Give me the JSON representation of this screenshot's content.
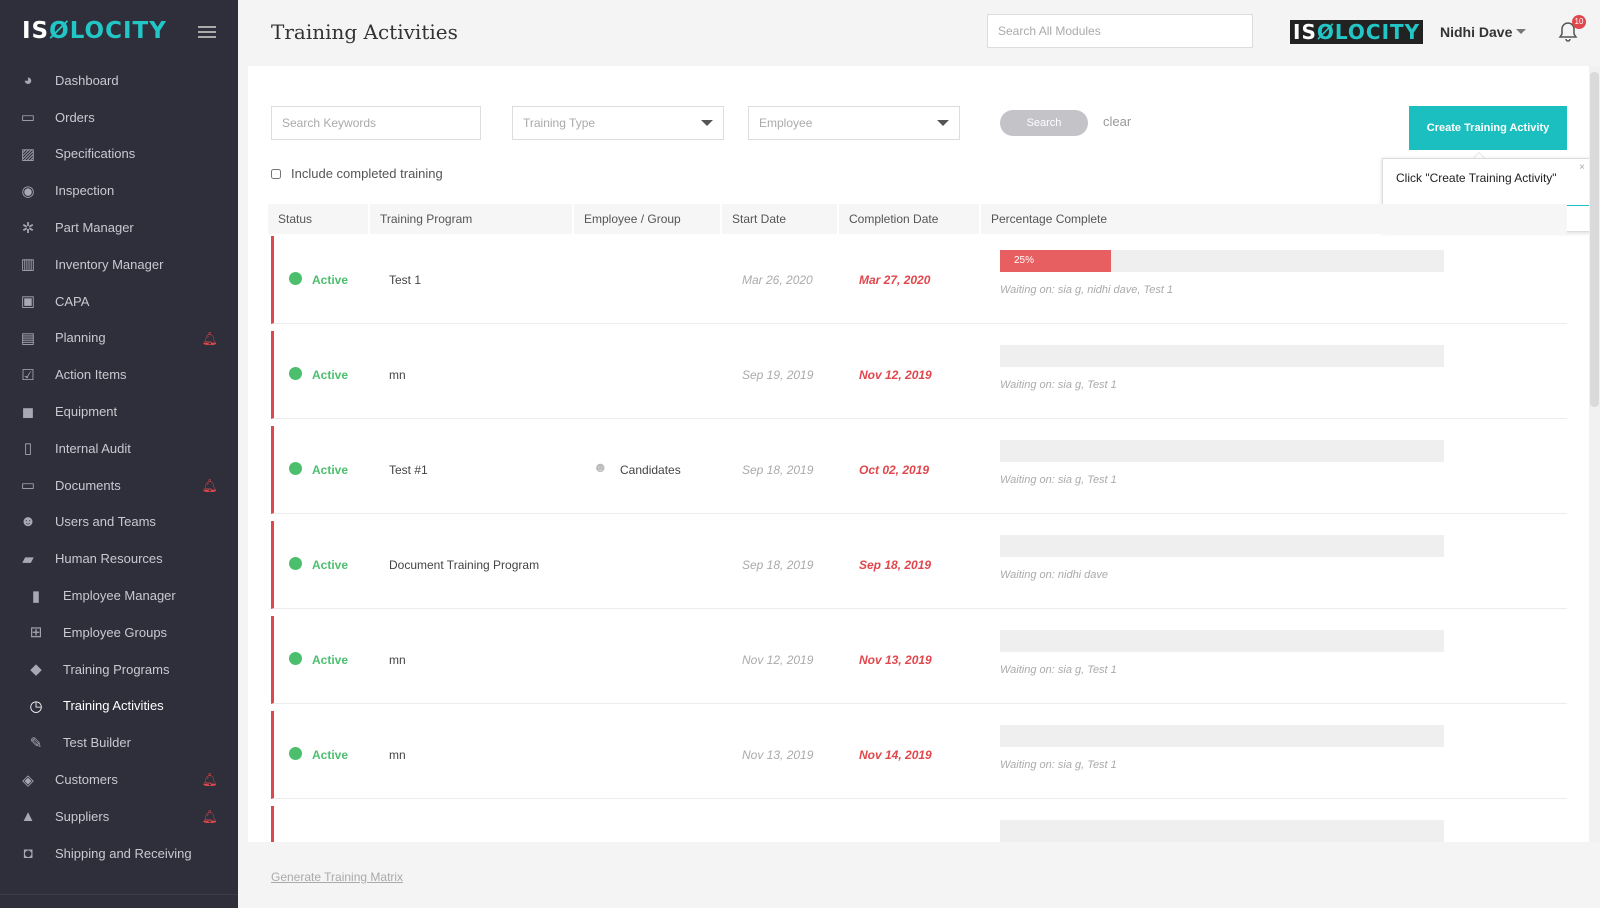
{
  "sidebar": {
    "logo": {
      "part1": "IS",
      "o": "Ø",
      "part2": "LOCITY"
    },
    "items": [
      {
        "label": "Dashboard",
        "icon": "dashboard-icon"
      },
      {
        "label": "Orders",
        "icon": "inbox-icon"
      },
      {
        "label": "Specifications",
        "icon": "image-icon"
      },
      {
        "label": "Inspection",
        "icon": "eye-icon"
      },
      {
        "label": "Part Manager",
        "icon": "gear-icon"
      },
      {
        "label": "Inventory Manager",
        "icon": "barcode-icon"
      },
      {
        "label": "CAPA",
        "icon": "briefcase-icon"
      },
      {
        "label": "Planning",
        "icon": "map-icon"
      },
      {
        "label": "Action Items",
        "icon": "checkbox-icon"
      },
      {
        "label": "Equipment",
        "icon": "truck-icon"
      },
      {
        "label": "Internal Audit",
        "icon": "document-icon"
      },
      {
        "label": "Documents",
        "icon": "folder-icon"
      },
      {
        "label": "Users and Teams",
        "icon": "users-icon"
      },
      {
        "label": "Human Resources",
        "icon": "book-icon"
      },
      {
        "label": "Employee Manager",
        "icon": "id-card-icon"
      },
      {
        "label": "Employee Groups",
        "icon": "sitemap-icon"
      },
      {
        "label": "Training Programs",
        "icon": "graduation-cap-icon"
      },
      {
        "label": "Training Activities",
        "icon": "clock-icon"
      },
      {
        "label": "Test Builder",
        "icon": "pencil-icon"
      },
      {
        "label": "Customers",
        "icon": "tag-icon"
      },
      {
        "label": "Suppliers",
        "icon": "supplier-icon"
      },
      {
        "label": "Shipping and Receiving",
        "icon": "tray-icon"
      }
    ]
  },
  "header": {
    "title": "Training Activities",
    "search_placeholder": "Search All Modules",
    "brand": {
      "part1": "IS",
      "o": "Ø",
      "part2": "LOCITY"
    },
    "user_name": "Nidhi Dave",
    "notification_count": "10"
  },
  "filters": {
    "keyword_placeholder": "Search Keywords",
    "training_type": "Training Type",
    "employee": "Employee",
    "search_label": "Search",
    "clear_label": "clear",
    "include_completed_label": "Include completed training"
  },
  "create_button_label": "Create Training Activity",
  "tooltip_text": "Click \"Create Training Activity\"",
  "tooltip_close": "×",
  "columns": {
    "status": "Status",
    "program": "Training Program",
    "group": "Employee / Group",
    "start": "Start Date",
    "completion": "Completion Date",
    "percent": "Percentage Complete"
  },
  "rows": [
    {
      "status": "Active",
      "program": "Test 1",
      "group": "",
      "start": "Mar 26, 2020",
      "completion": "Mar 27, 2020",
      "percent": 25,
      "percent_label": "25%",
      "waiting": "Waiting on: sia g, nidhi dave, Test 1"
    },
    {
      "status": "Active",
      "program": "mn",
      "group": "",
      "start": "Sep 19, 2019",
      "completion": "Nov 12, 2019",
      "percent": 0,
      "percent_label": "",
      "waiting": "Waiting on: sia g, Test 1"
    },
    {
      "status": "Active",
      "program": "Test #1",
      "group": "Candidates",
      "start": "Sep 18, 2019",
      "completion": "Oct 02, 2019",
      "percent": 0,
      "percent_label": "",
      "waiting": "Waiting on: sia g, Test 1"
    },
    {
      "status": "Active",
      "program": "Document Training Program",
      "group": "",
      "start": "Sep 18, 2019",
      "completion": "Sep 18, 2019",
      "percent": 0,
      "percent_label": "",
      "waiting": "Waiting on: nidhi dave"
    },
    {
      "status": "Active",
      "program": "mn",
      "group": "",
      "start": "Nov 12, 2019",
      "completion": "Nov 13, 2019",
      "percent": 0,
      "percent_label": "",
      "waiting": "Waiting on: sia g, Test 1"
    },
    {
      "status": "Active",
      "program": "mn",
      "group": "",
      "start": "Nov 13, 2019",
      "completion": "Nov 14, 2019",
      "percent": 0,
      "percent_label": "",
      "waiting": "Waiting on: sia g, Test 1"
    }
  ],
  "footer_link": "Generate Training Matrix",
  "colors": {
    "accent": "#1cbfbf",
    "active": "#4cbf6e",
    "danger": "#e0474c",
    "sidebar": "#2f2f3b"
  }
}
